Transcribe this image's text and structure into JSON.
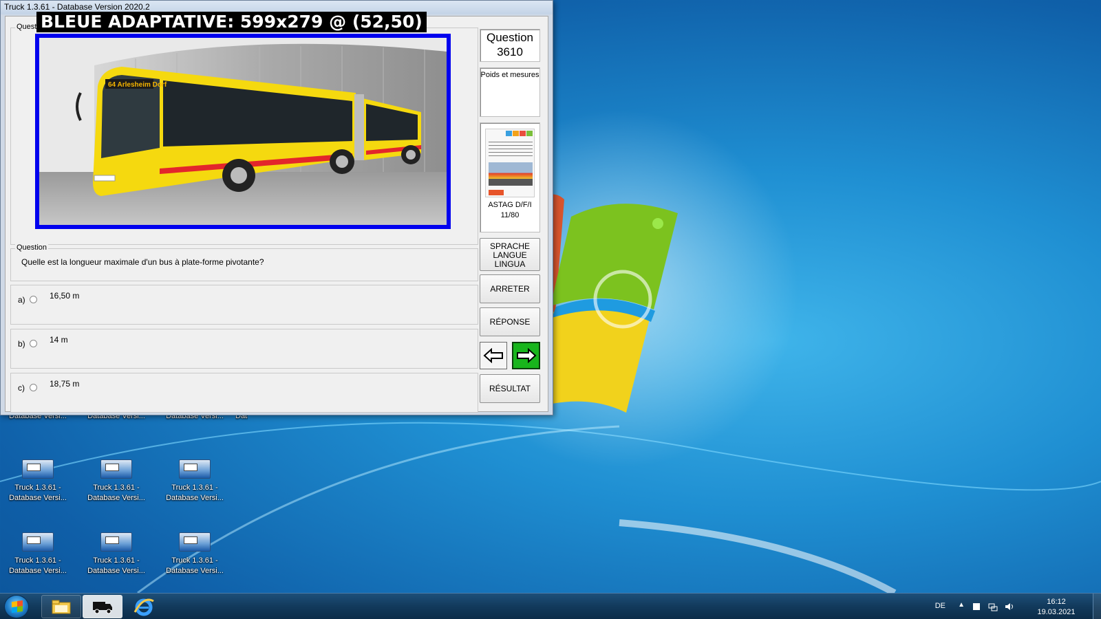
{
  "window": {
    "title": "Truck 1.3.61 - Database Version 2020.2"
  },
  "overlay": {
    "label": "BLEUE ADAPTATIVE: 599x279 @ (52,50)"
  },
  "panels": {
    "top_legend": "Questio",
    "question_legend": "Question"
  },
  "question": {
    "number_label": "Question",
    "number": "3610",
    "category": "Poids et mesures",
    "text": "Quelle est la longueur maximale d'un bus à plate-forme pivotante?",
    "image_alt": "articulated yellow bus",
    "bus_route_sign": "64 Arlesheim Dorf",
    "source_line1": "ASTAG D/F/I",
    "source_line2": "11/80"
  },
  "answers": [
    {
      "letter": "a)",
      "value": "16,50 m"
    },
    {
      "letter": "b)",
      "value": "14 m"
    },
    {
      "letter": "c)",
      "value": "18,75 m"
    }
  ],
  "buttons": {
    "language_line1": "SPRACHE",
    "language_line2": "LANGUE",
    "language_line3": "LINGUA",
    "stop": "ARRETER",
    "answer": "RÉPONSE",
    "result": "RÉSULTAT",
    "prev_icon": "arrow-left-icon",
    "next_icon": "arrow-right-icon"
  },
  "desktop": {
    "partial_row_label": "Database Versi...",
    "icons": [
      {
        "line1": "Truck 1.3.61 -",
        "line2": "Database Versi..."
      },
      {
        "line1": "Truck 1.3.61 -",
        "line2": "Database Versi..."
      },
      {
        "line1": "Truck 1.3.61 -",
        "line2": "Database Versi..."
      },
      {
        "line1": "Truck 1.3.61 -",
        "line2": "Database Versi..."
      },
      {
        "line1": "Truck 1.3.61 -",
        "line2": "Database Versi..."
      },
      {
        "line1": "Truck 1.3.61 -",
        "line2": "Database Versi..."
      }
    ]
  },
  "taskbar": {
    "apps": [
      "start-orb",
      "file-explorer-icon",
      "truck-app-icon",
      "internet-explorer-icon"
    ],
    "language": "DE",
    "time": "16:12",
    "date": "19.03.2021"
  },
  "colors": {
    "image_border": "#0000ee",
    "next_button": "#18b51c",
    "bus_yellow": "#f5d90f",
    "bus_red_stripe": "#e3262b"
  }
}
